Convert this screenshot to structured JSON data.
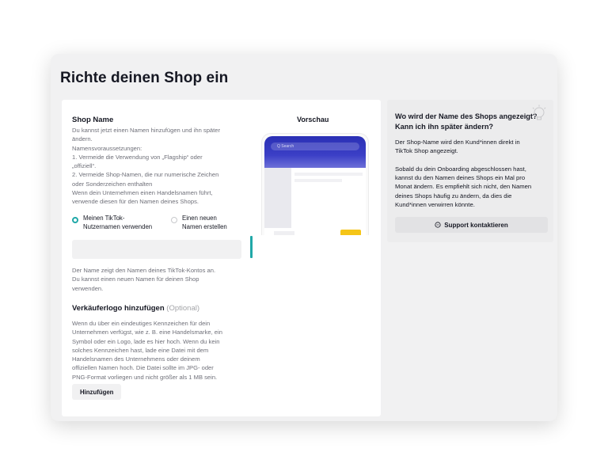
{
  "page": {
    "title": "Richte deinen Shop ein"
  },
  "form": {
    "heading": "Shop Name",
    "intro_lines": [
      "Du kannst jetzt einen Namen hinzufügen und ihn später",
      "ändern.",
      "Namensvoraussetzungen:",
      "1. Vermeide die Verwendung von „Flagship“ oder",
      "„offiziell“.",
      "2. Vermeide Shop-Namen, die nur numerische Zeichen",
      "oder Sonderzeichen enthalten",
      "Wenn dein Unternehmen einen Handelsnamen führt,",
      "verwende diesen für den Namen deines Shops."
    ],
    "radio_options": [
      {
        "line1": "Meinen TikTok-",
        "line2": "Nutzernamen verwenden",
        "selected": true
      },
      {
        "line1": "Einen neuen",
        "line2": "Namen erstellen",
        "selected": false
      }
    ],
    "name_input_value": "",
    "helper_lines": [
      "Der Name zeigt den Namen deines TikTok-Kontos an.",
      "Du kannst einen neuen Namen für deinen Shop",
      "verwenden."
    ],
    "logo_heading": "Verkäuferlogo hinzufügen",
    "logo_optional": "(Optional)",
    "logo_desc_lines": [
      "Wenn du über ein eindeutiges Kennzeichen für dein",
      "Unternehmen verfügst, wie z. B. eine Handelsmarke, ein",
      "Symbol oder ein Logo, lade es hier hoch. Wenn du kein",
      "solches Kennzeichen hast, lade eine Datei mit dem",
      "Handelsnamen des Unternehmens oder deinem",
      "offiziellen Namen hoch. Die Datei sollte im JPG- oder",
      "PNG-Format vorliegen und nicht größer als 1 MB sein."
    ],
    "add_button": "Hinzufügen"
  },
  "preview": {
    "label": "Vorschau",
    "search_placeholder": "Q Search"
  },
  "info": {
    "title_lines": [
      "Wo wird der Name des Shops angezeigt?",
      "Kann ich ihn später ändern?"
    ],
    "para1_lines": [
      "Der Shop-Name wird den Kund*innen direkt in",
      "TikTok Shop angezeigt."
    ],
    "para2_lines": [
      "Sobald du dein Onboarding abgeschlossen hast,",
      "kannst du den Namen deines Shops ein Mal pro",
      "Monat ändern. Es empfiehlt sich nicht, den Namen",
      "deines Shops häufig zu ändern, da dies die",
      "Kund*innen verwirren könnte."
    ],
    "support_button": "Support kontaktieren"
  },
  "colors": {
    "accent_teal": "#20a8a8",
    "preview_header_blue": "#2a2fb5",
    "page_card_bg": "#f1f1f2"
  },
  "icons": {
    "radio_selected": "radio-selected-icon",
    "radio_unselected": "radio-unselected-icon",
    "info_illustration": "lightbulb-icon",
    "support": "chat-bubble-icon"
  }
}
